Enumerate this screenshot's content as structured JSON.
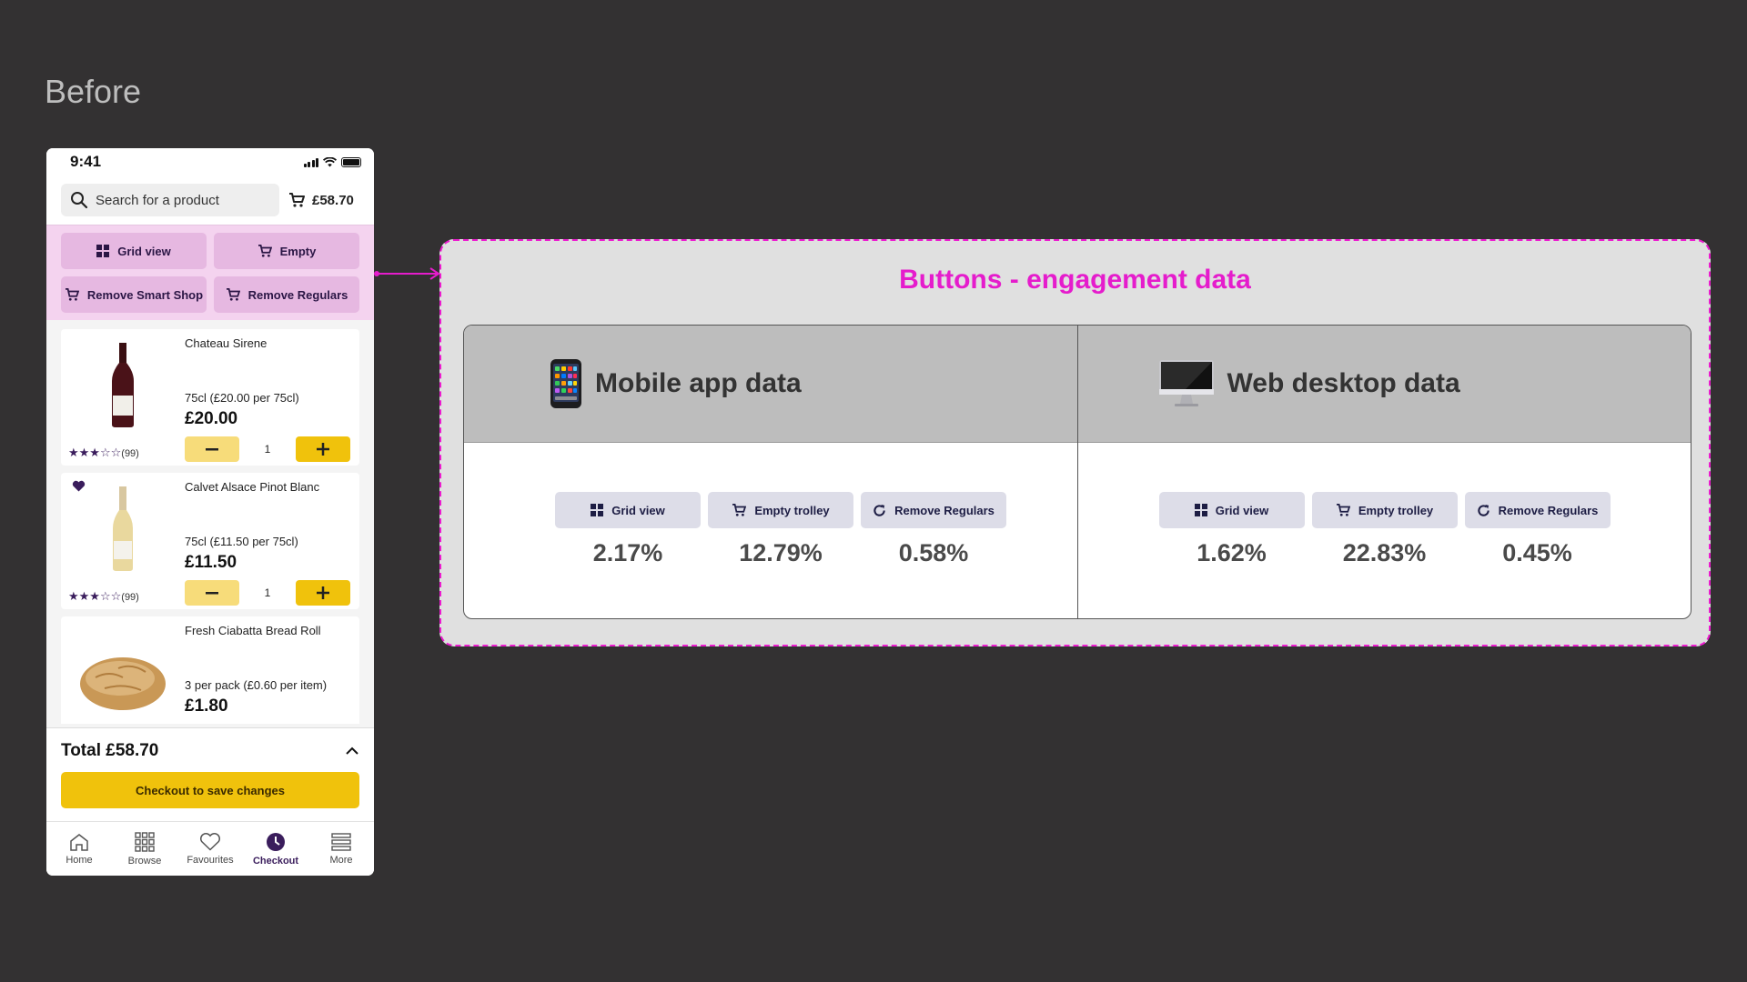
{
  "heading": "Before",
  "phone": {
    "status_time": "9:41",
    "search_placeholder": "Search for a product",
    "basket_total": "£58.70",
    "actions": [
      {
        "label": "Grid view",
        "icon": "grid-icon"
      },
      {
        "label": "Empty",
        "icon": "trolley-icon"
      },
      {
        "label": "Remove Smart Shop",
        "icon": "trolley-icon"
      },
      {
        "label": "Remove Regulars",
        "icon": "trolley-icon"
      }
    ],
    "products": [
      {
        "name": "Chateau Sirene",
        "per": "75cl (£20.00 per 75cl)",
        "price": "£20.00",
        "rating_count": "(99)",
        "qty": "1",
        "image": "red-wine-bottle"
      },
      {
        "name": "Calvet Alsace Pinot Blanc",
        "per": "75cl (£11.50 per 75cl)",
        "price": "£11.50",
        "rating_count": "(99)",
        "qty": "1",
        "image": "white-wine-bottle",
        "favourite": true
      },
      {
        "name": "Fresh Ciabatta Bread Roll",
        "per": "3 per pack  (£0.60 per item)",
        "price": "£1.80",
        "image": "bread-roll"
      }
    ],
    "total_label": "Total £58.70",
    "checkout_label": "Checkout to save changes",
    "tabs": [
      {
        "label": "Home",
        "icon": "home-icon"
      },
      {
        "label": "Browse",
        "icon": "browse-icon"
      },
      {
        "label": "Favourites",
        "icon": "heart-icon"
      },
      {
        "label": "Checkout",
        "icon": "checkout-icon",
        "active": true
      },
      {
        "label": "More",
        "icon": "menu-icon"
      }
    ]
  },
  "panel": {
    "title": "Buttons - engagement data",
    "columns": [
      {
        "heading": "Mobile app data",
        "icon": "mobile-phone-icon",
        "metrics": [
          {
            "label": "Grid view",
            "icon": "grid-icon",
            "value": "2.17%"
          },
          {
            "label": "Empty trolley",
            "icon": "trolley-icon",
            "value": "12.79%"
          },
          {
            "label": "Remove Regulars",
            "icon": "refresh-icon",
            "value": "0.58%"
          }
        ]
      },
      {
        "heading": "Web desktop data",
        "icon": "desktop-computer-icon",
        "metrics": [
          {
            "label": "Grid view",
            "icon": "grid-icon",
            "value": "1.62%"
          },
          {
            "label": "Empty trolley",
            "icon": "trolley-icon",
            "value": "22.83%"
          },
          {
            "label": "Remove Regulars",
            "icon": "refresh-icon",
            "value": "0.45%"
          }
        ]
      }
    ]
  },
  "colors": {
    "background": "#333132",
    "accent_magenta": "#e51ccc",
    "action_pink": "#e6b8e1",
    "brand_yellow": "#f0c20c",
    "brand_purple": "#3a1d5c"
  }
}
